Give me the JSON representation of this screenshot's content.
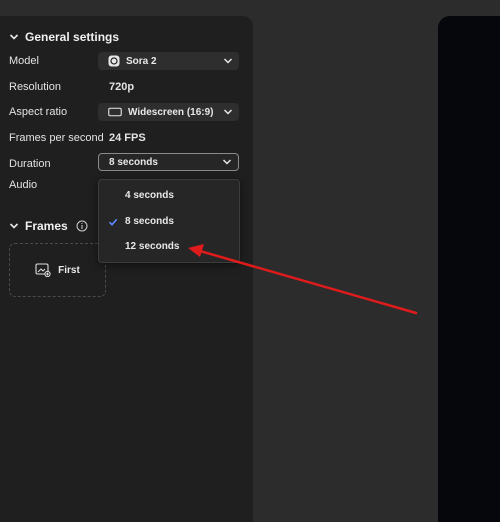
{
  "general": {
    "title": "General settings",
    "model_label": "Model",
    "model_value": "Sora 2",
    "resolution_label": "Resolution",
    "resolution_value": "720p",
    "aspect_label": "Aspect ratio",
    "aspect_value": "Widescreen (16:9)",
    "fps_label": "Frames per second",
    "fps_value": "24 FPS",
    "duration_label": "Duration",
    "duration_value": "8 seconds",
    "audio_label": "Audio"
  },
  "duration_dropdown": {
    "options": [
      "4 seconds",
      "8 seconds",
      "12 seconds"
    ],
    "selected": "8 seconds"
  },
  "frames": {
    "title": "Frames",
    "first_label": "First"
  },
  "colors": {
    "panel": "#1f1f1f",
    "background": "#2c2c2c",
    "check": "#5b8cff",
    "arrow": "#e01b1b",
    "preview": "#06060d"
  }
}
